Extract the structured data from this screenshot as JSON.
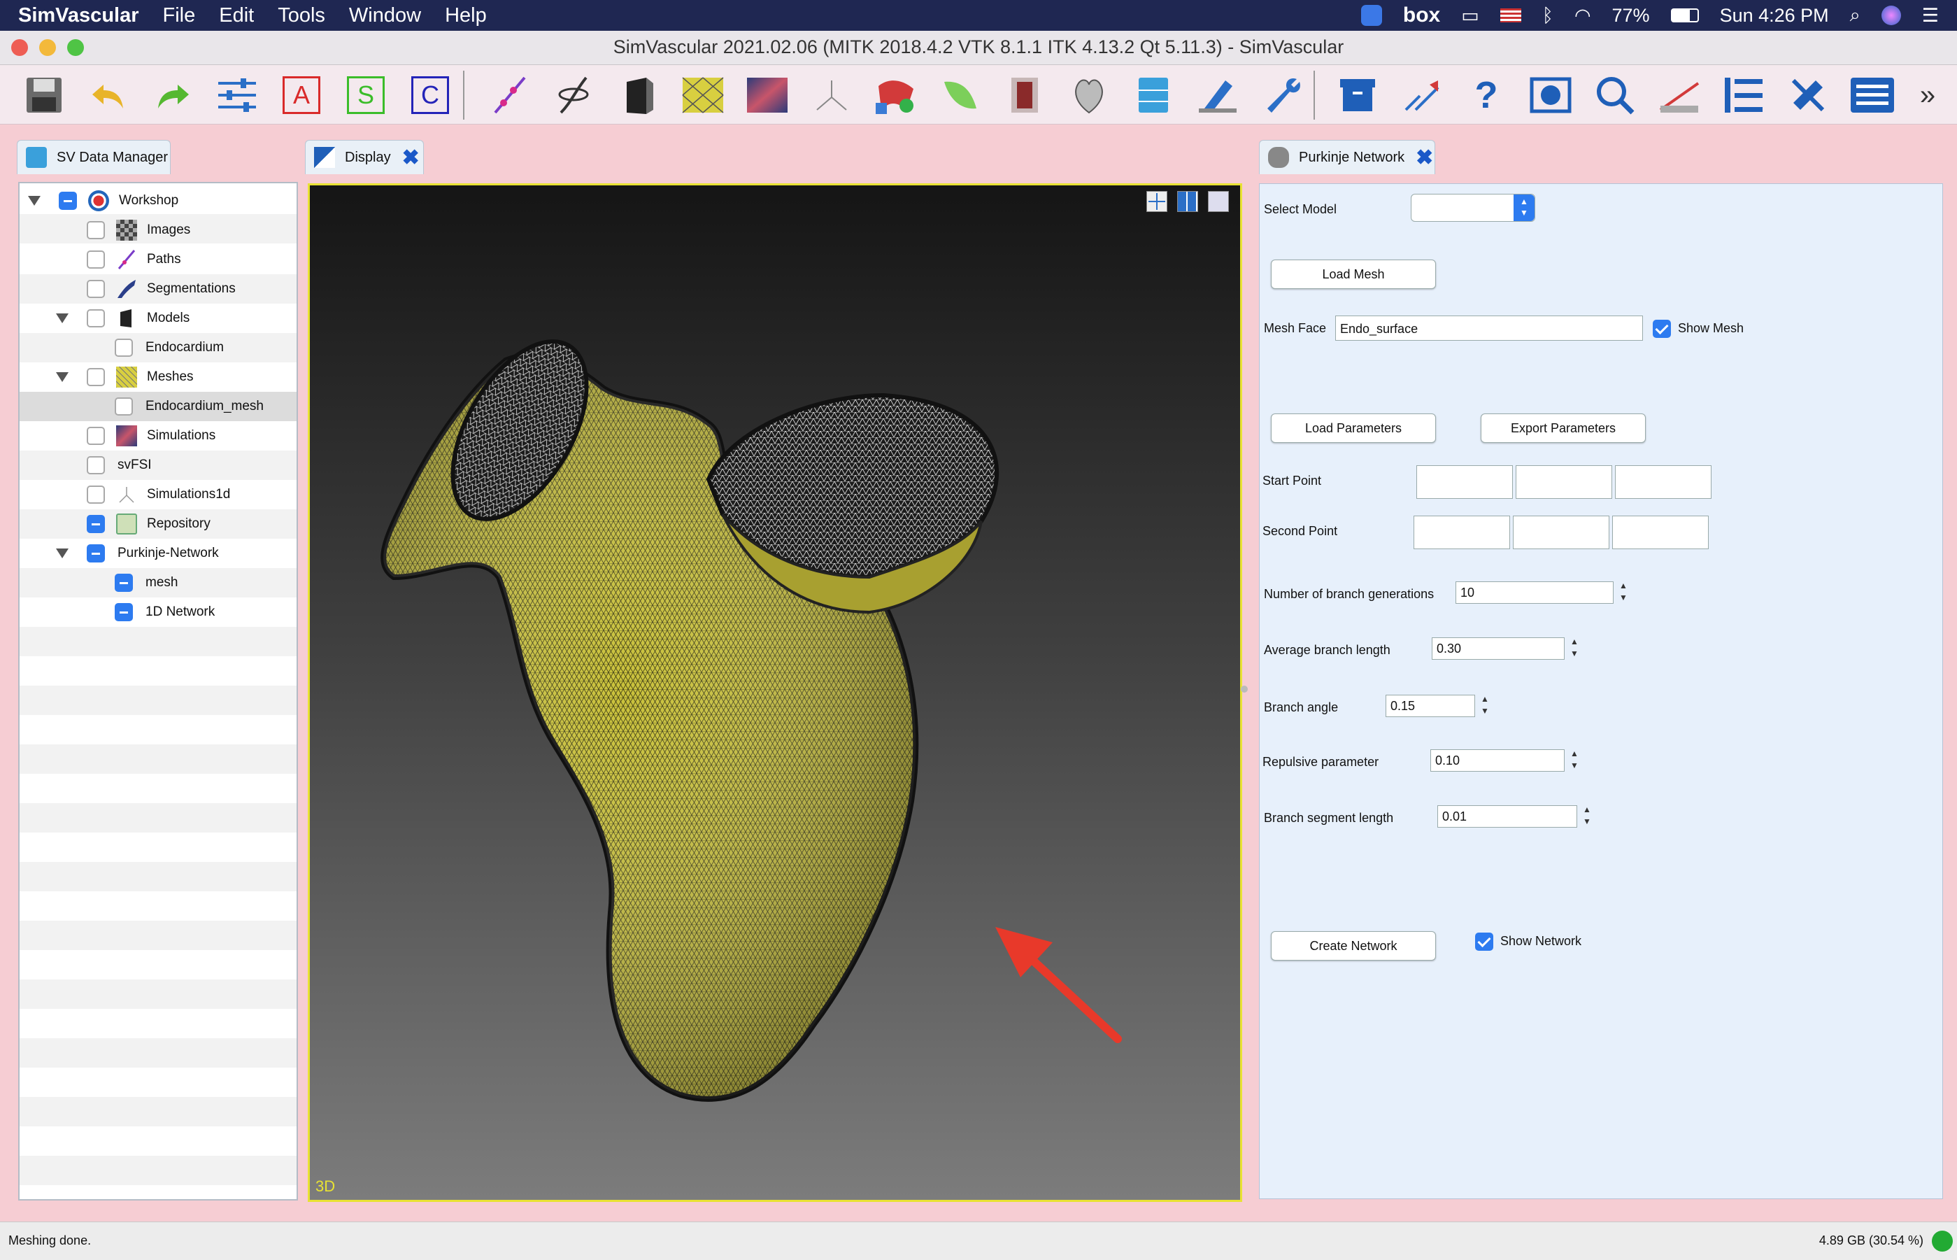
{
  "menubar": {
    "app": "SimVascular",
    "items": [
      "File",
      "Edit",
      "Tools",
      "Window",
      "Help"
    ],
    "battery": "77%",
    "clock": "Sun 4:26 PM",
    "box_label": "box"
  },
  "window": {
    "title": "SimVascular 2021.02.06 (MITK 2018.4.2 VTK 8.1.1 ITK 4.13.2 Qt 5.11.3) - SimVascular"
  },
  "toolbar": {
    "letters": {
      "a": "A",
      "s": "S",
      "c": "C"
    },
    "help": "?",
    "more": "»"
  },
  "data_manager": {
    "tab_label": "SV Data Manager",
    "tree": {
      "workshop": "Workshop",
      "images": "Images",
      "paths": "Paths",
      "segmentations": "Segmentations",
      "models": "Models",
      "endocardium": "Endocardium",
      "meshes": "Meshes",
      "endocardium_mesh": "Endocardium_mesh",
      "simulations": "Simulations",
      "svfsi": "svFSI",
      "simulations1d": "Simulations1d",
      "repository": "Repository",
      "purkinje_network": "Purkinje-Network",
      "mesh": "mesh",
      "network_1d": "1D Network"
    }
  },
  "display": {
    "tab_label": "Display",
    "view_label": "3D"
  },
  "purkinje": {
    "tab_label": "Purkinje Network",
    "select_model_label": "Select Model",
    "select_model_value": "",
    "load_mesh": "Load Mesh",
    "mesh_face_label": "Mesh Face",
    "mesh_face_value": "Endo_surface",
    "show_mesh": "Show Mesh",
    "load_parameters": "Load Parameters",
    "export_parameters": "Export Parameters",
    "start_point_label": "Start Point",
    "second_point_label": "Second Point",
    "num_generations_label": "Number of branch generations",
    "num_generations_value": "10",
    "avg_branch_length_label": "Average branch length",
    "avg_branch_length_value": "0.30",
    "branch_angle_label": "Branch angle",
    "branch_angle_value": "0.15",
    "repulsive_label": "Repulsive parameter",
    "repulsive_value": "0.10",
    "segment_length_label": "Branch segment length",
    "segment_length_value": "0.01",
    "create_network": "Create Network",
    "show_network": "Show Network"
  },
  "status": {
    "message": "Meshing done.",
    "memory": "4.89 GB (30.54 %)"
  },
  "colors": {
    "mesh_fill": "#c9c13a",
    "viewport_border": "#e8e233",
    "accent": "#2d7bf0",
    "annotation_arrow": "#e8392a"
  }
}
